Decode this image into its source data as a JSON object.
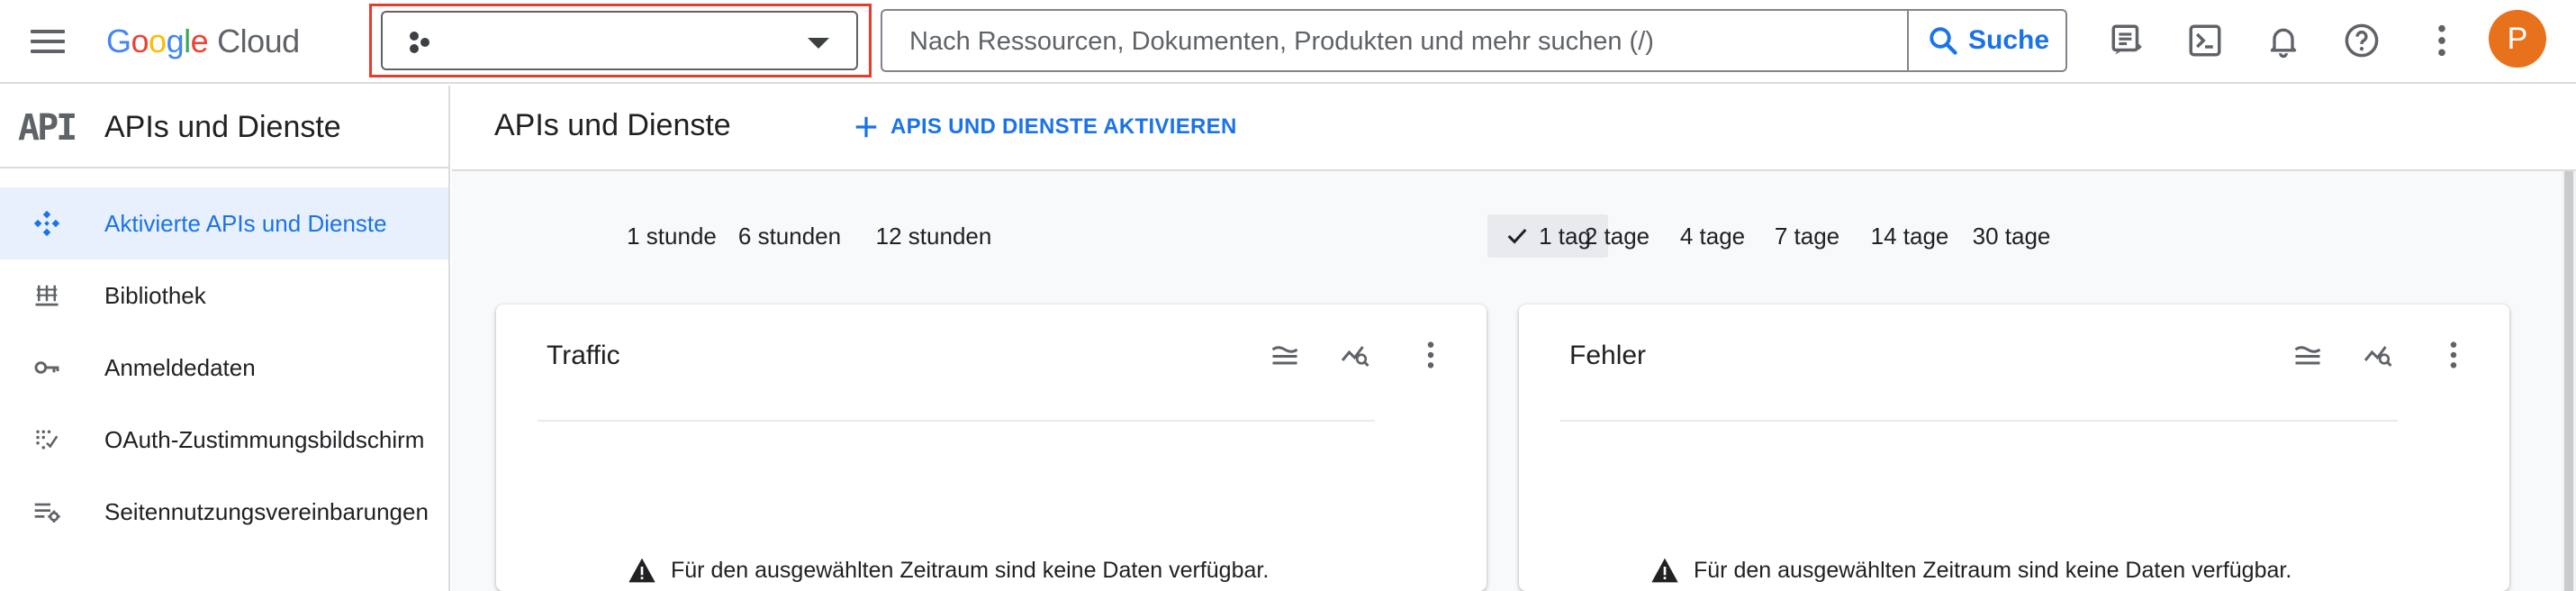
{
  "header": {
    "logo_google": [
      "G",
      "o",
      "o",
      "g",
      "l",
      "e"
    ],
    "logo_cloud": "Cloud",
    "search_placeholder": "Nach Ressourcen, Dokumenten, Produkten und mehr suchen (/)",
    "search_button": "Suche",
    "avatar_initial": "P"
  },
  "sidebar": {
    "logo_text": "API",
    "title": "APIs und Dienste",
    "items": [
      {
        "label": "Aktivierte APIs und Dienste",
        "icon": "api-diamond-icon",
        "active": true
      },
      {
        "label": "Bibliothek",
        "icon": "library-icon",
        "active": false
      },
      {
        "label": "Anmeldedaten",
        "icon": "key-icon",
        "active": false
      },
      {
        "label": "OAuth-Zustimmungsbildschirm",
        "icon": "oauth-consent-icon",
        "active": false
      },
      {
        "label": "Seitennutzungsvereinbarungen",
        "icon": "page-usage-settings-icon",
        "active": false
      }
    ]
  },
  "main": {
    "title": "APIs und Dienste",
    "enable_button": "APIS UND DIENSTE AKTIVIEREN",
    "time_ranges": [
      "1 stunde",
      "6 stunden",
      "12 stunden",
      "1 tag",
      "2 tage",
      "4 tage",
      "7 tage",
      "14 tage",
      "30 tage"
    ],
    "selected_range": "1 tag",
    "cards": [
      {
        "title": "Traffic",
        "message": "Für den ausgewählten Zeitraum sind keine Daten verfügbar."
      },
      {
        "title": "Fehler",
        "message": "Für den ausgewählten Zeitraum sind keine Daten verfügbar."
      }
    ]
  },
  "colors": {
    "accent": "#1a73e8",
    "active_nav_bg": "#e8f0fe",
    "avatar_bg": "#e8711c",
    "highlight_box": "#e53c2c"
  }
}
